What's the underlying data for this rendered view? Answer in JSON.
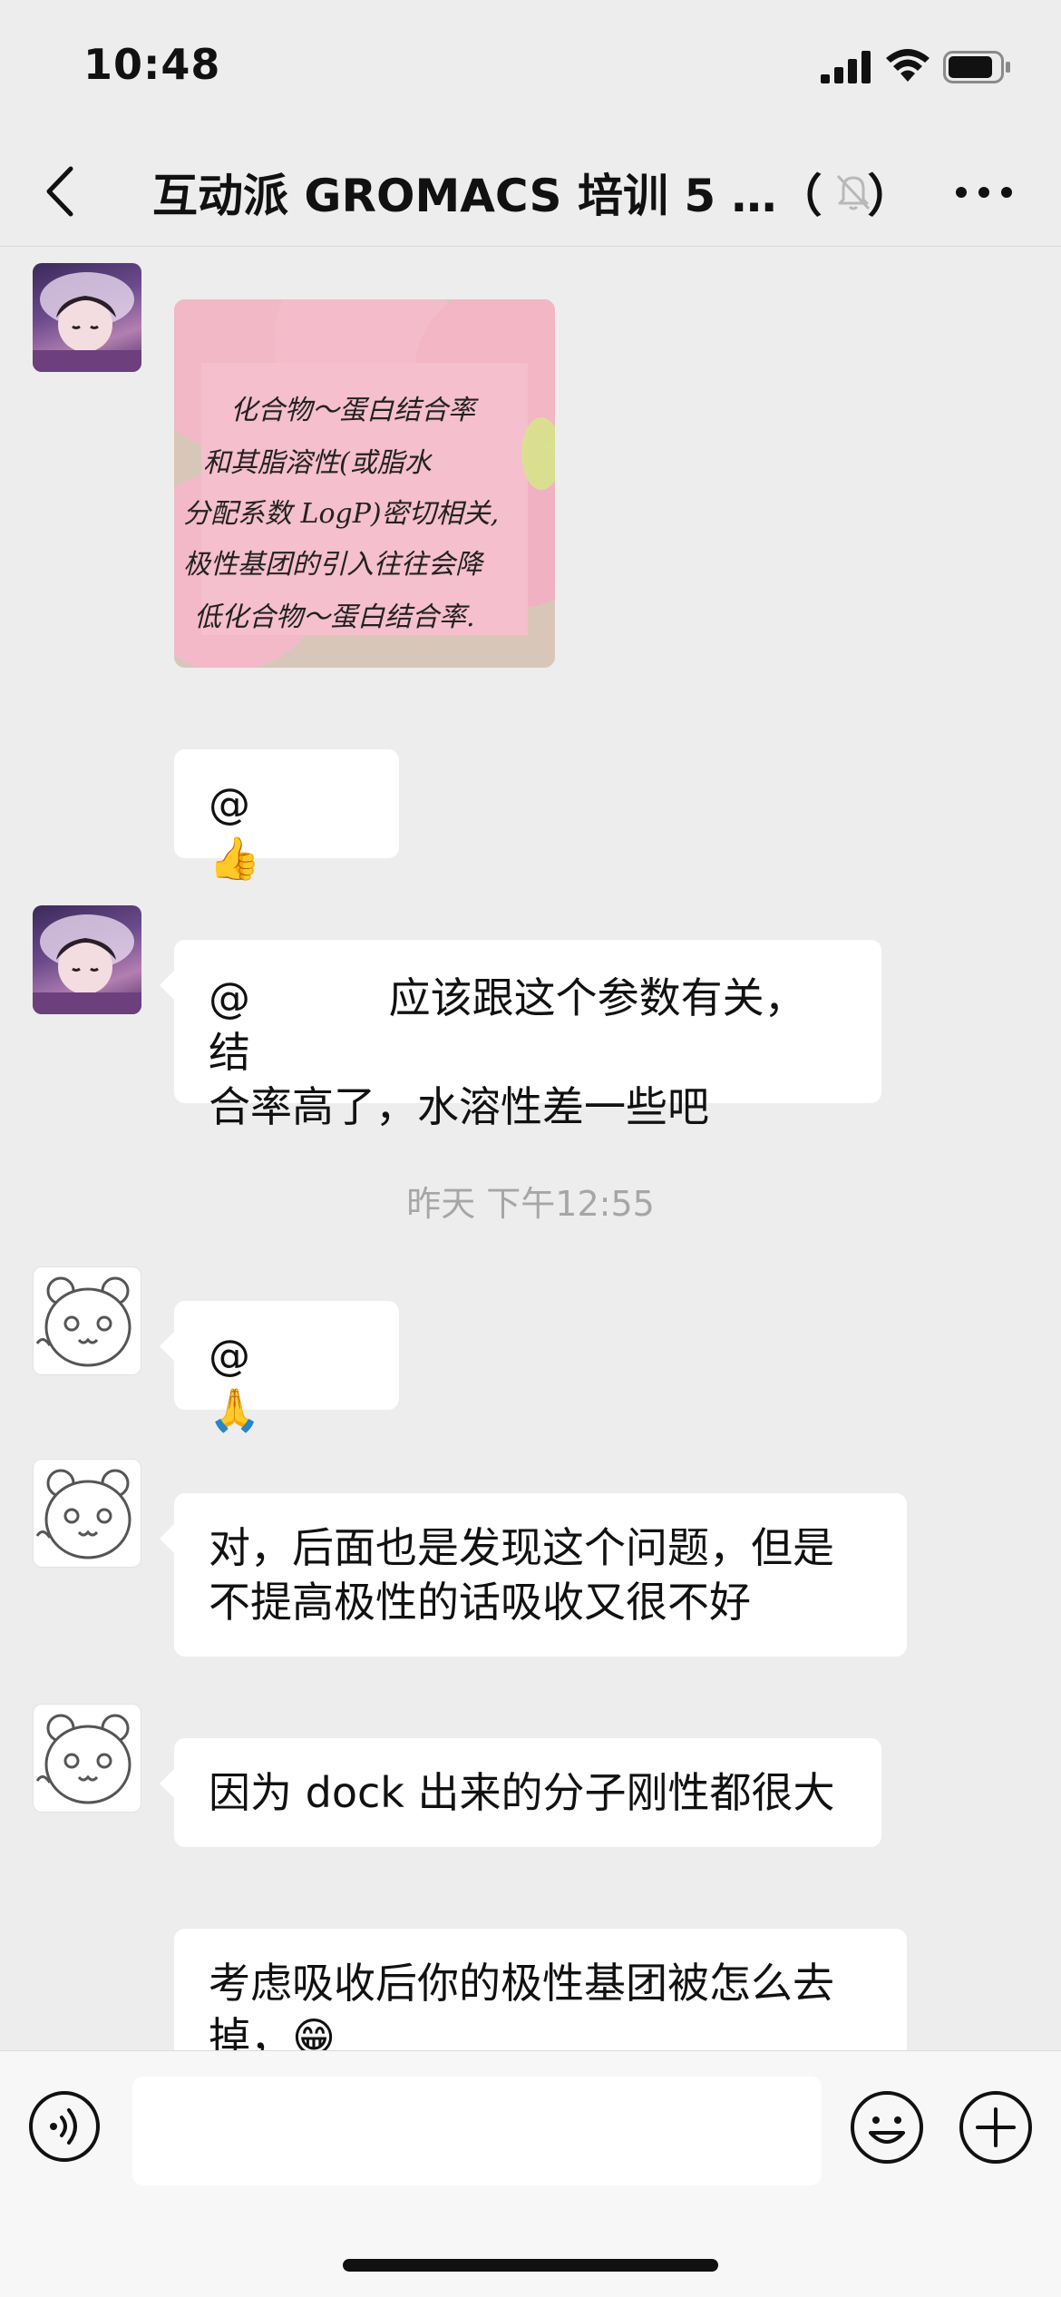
{
  "status_bar": {
    "time": "10:48"
  },
  "header": {
    "title": "互动派 GROMACS 培训 5 …（　）"
  },
  "image_note": {
    "lines": [
      "化合物〜蛋白结合率",
      "和其脂溶性(或脂水",
      "分配系数 LogP)密切相关,",
      "极性基团的引入往往会降",
      "低化合物〜蛋白结合率."
    ]
  },
  "messages": {
    "m1": {
      "text": "@　　　👍"
    },
    "m2": {
      "line1": "@　　　 应该跟这个参数有关，结",
      "line2": "合率高了，水溶性差一些吧"
    },
    "timestamp": "昨天 下午12:55",
    "m3": {
      "text": "@　　　🙏"
    },
    "m4": {
      "line1": "对，后面也是发现这个问题，但是",
      "line2": "不提高极性的话吸收又很不好"
    },
    "m5": {
      "text": "因为 dock 出来的分子刚性都很大"
    },
    "m6": {
      "line1": "考虑吸收后你的极性基团被怎么去",
      "line2": "掉，😁"
    }
  },
  "input": {
    "placeholder": ""
  },
  "icons": {
    "back": "chevron-left-icon",
    "mute": "bell-slash-icon",
    "more": "ellipsis-icon",
    "voice": "voice-icon",
    "emoji": "smiley-icon",
    "plus": "plus-icon"
  }
}
